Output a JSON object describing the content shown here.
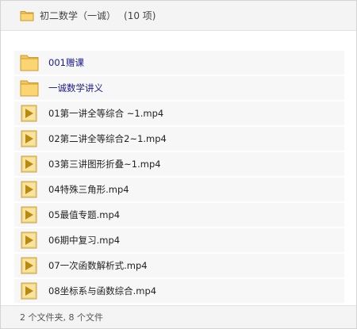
{
  "header": {
    "title": "初二数学（一诚）",
    "count": "(10 项)",
    "icon": "folder-icon"
  },
  "items": [
    {
      "type": "folder",
      "name": "001赠课",
      "icon": "folder-icon"
    },
    {
      "type": "folder",
      "name": "一诚数学讲义",
      "icon": "folder-icon"
    },
    {
      "type": "video",
      "name": "01第一讲全等综合 ~1.mp4",
      "icon": "video-file-icon"
    },
    {
      "type": "video",
      "name": "02第二讲全等综合2~1.mp4",
      "icon": "video-file-icon"
    },
    {
      "type": "video",
      "name": "03第三讲图形折叠~1.mp4",
      "icon": "video-file-icon"
    },
    {
      "type": "video",
      "name": "04特殊三角形.mp4",
      "icon": "video-file-icon"
    },
    {
      "type": "video",
      "name": "05最值专题.mp4",
      "icon": "video-file-icon"
    },
    {
      "type": "video",
      "name": "06期中复习.mp4",
      "icon": "video-file-icon"
    },
    {
      "type": "video",
      "name": "07一次函数解析式.mp4",
      "icon": "video-file-icon"
    },
    {
      "type": "video",
      "name": "08坐标系与函数综合.mp4",
      "icon": "video-file-icon"
    }
  ],
  "footer": {
    "status": "2 个文件夹, 8 个文件"
  },
  "colors": {
    "folder_fill": "#f7c65a",
    "folder_stroke": "#c99a2e",
    "video_fill": "#f3d57a",
    "video_play": "#b98a12",
    "folder_link": "#1a1a8c"
  }
}
